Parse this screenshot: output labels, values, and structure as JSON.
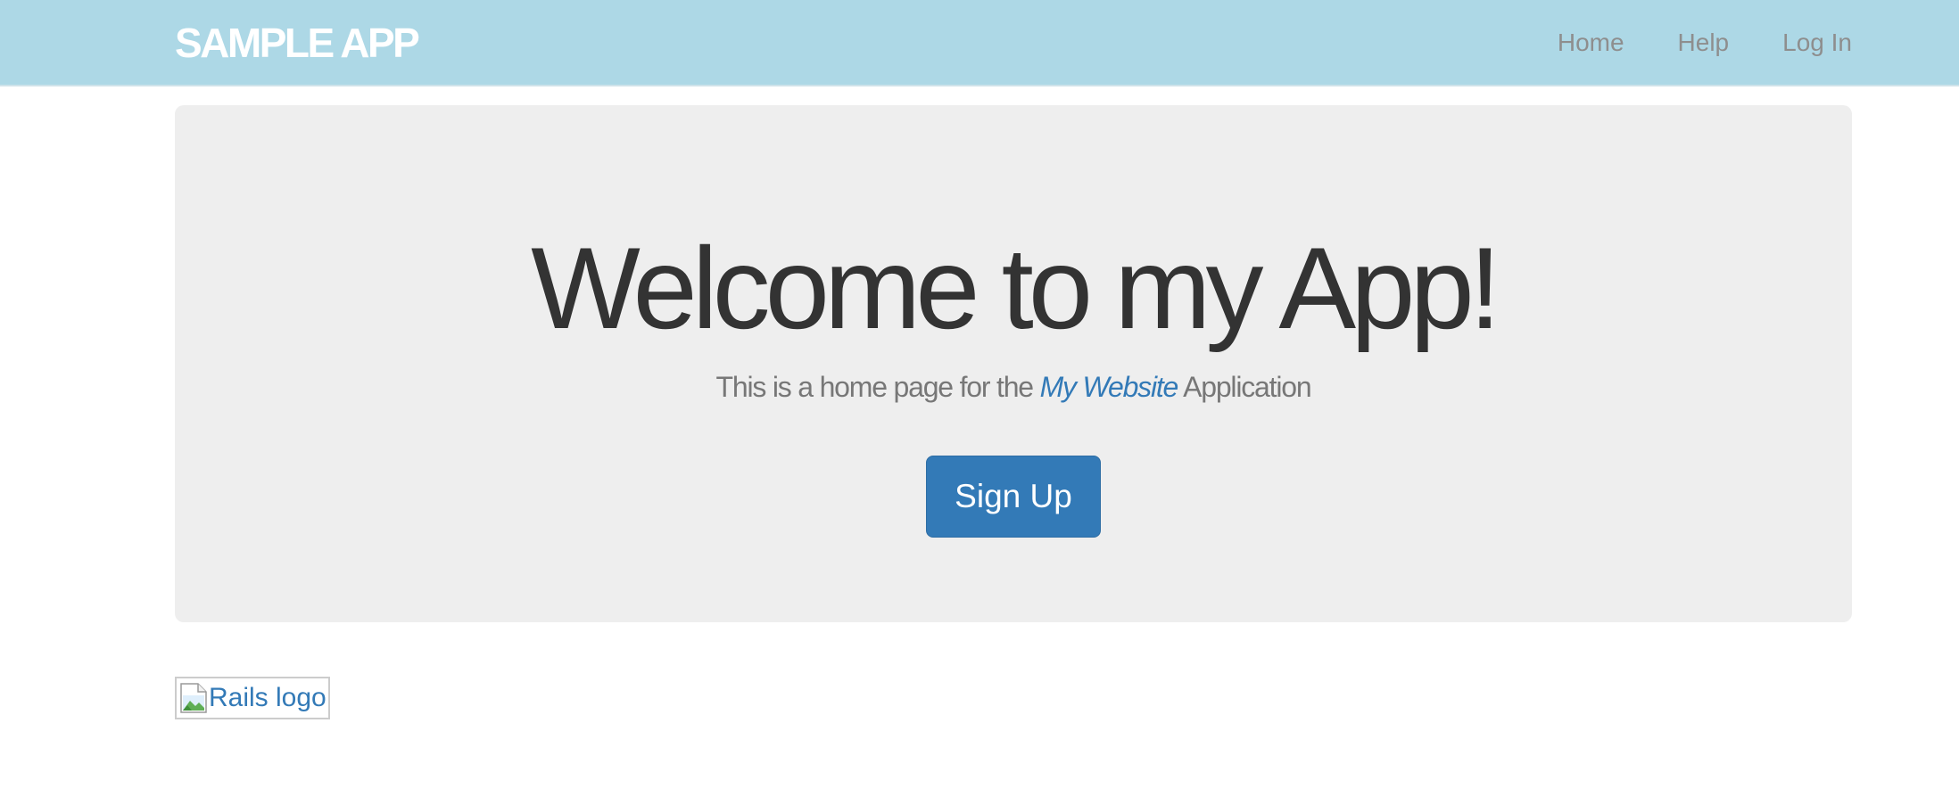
{
  "header": {
    "brand": "SAMPLE APP",
    "nav": [
      {
        "label": "Home"
      },
      {
        "label": "Help"
      },
      {
        "label": "Log In"
      }
    ]
  },
  "hero": {
    "title": "Welcome to my App!",
    "subtitle_before": "This is a home page for the ",
    "subtitle_link": "My Website",
    "subtitle_after": " Application",
    "cta_label": "Sign Up"
  },
  "footer_image": {
    "alt": "Rails logo",
    "icon": "broken-image-icon"
  },
  "colors": {
    "header_bg": "#add8e6",
    "brand_text": "#ffffff",
    "nav_text": "#8e8e8e",
    "jumbotron_bg": "#eeeeee",
    "headline_text": "#333333",
    "subtitle_text": "#777777",
    "link": "#337ab7",
    "button_bg": "#337ab7"
  }
}
